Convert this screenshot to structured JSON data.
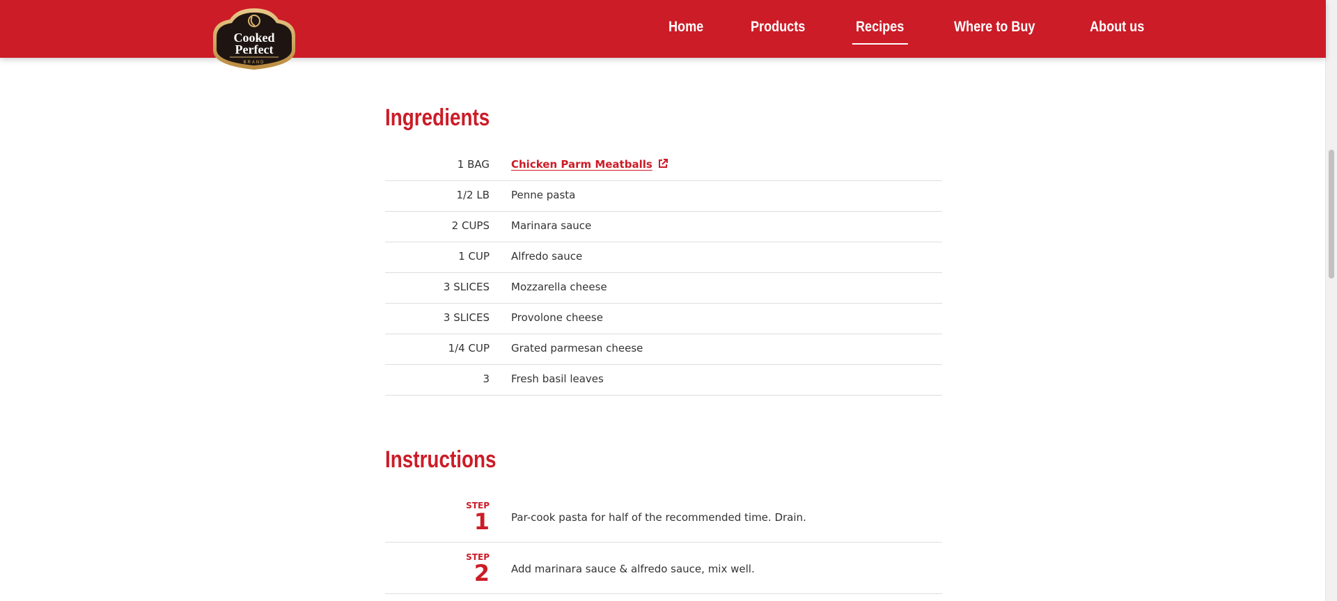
{
  "brand": {
    "logo_line1": "Cooked",
    "logo_line2": "Perfect",
    "logo_sub": "BRAND"
  },
  "nav": [
    {
      "label": "Home"
    },
    {
      "label": "Products"
    },
    {
      "label": "Recipes",
      "active": true
    },
    {
      "label": "Where to Buy"
    },
    {
      "label": "About us"
    }
  ],
  "ingredients": {
    "title": "Ingredients",
    "items": [
      {
        "qty": "1 BAG",
        "name": "Chicken Parm Meatballs",
        "link": true
      },
      {
        "qty": "1/2 LB",
        "name": "Penne pasta"
      },
      {
        "qty": "2 CUPS",
        "name": "Marinara sauce"
      },
      {
        "qty": "1 CUP",
        "name": "Alfredo sauce"
      },
      {
        "qty": "3 SLICES",
        "name": "Mozzarella cheese"
      },
      {
        "qty": "3 SLICES",
        "name": "Provolone cheese"
      },
      {
        "qty": "1/4 CUP",
        "name": "Grated parmesan cheese"
      },
      {
        "qty": "3",
        "name": "Fresh basil leaves"
      }
    ]
  },
  "instructions": {
    "title": "Instructions",
    "step_label": "STEP",
    "steps": [
      {
        "number": "1",
        "text": "Par-cook pasta for half of the recommended time. Drain."
      },
      {
        "number": "2",
        "text": "Add marinara sauce & alfredo sauce, mix well."
      }
    ]
  },
  "colors": {
    "brand_red": "#cc1c27",
    "divider": "#dddddd"
  },
  "icons": {
    "external_link": "external-link-icon"
  }
}
